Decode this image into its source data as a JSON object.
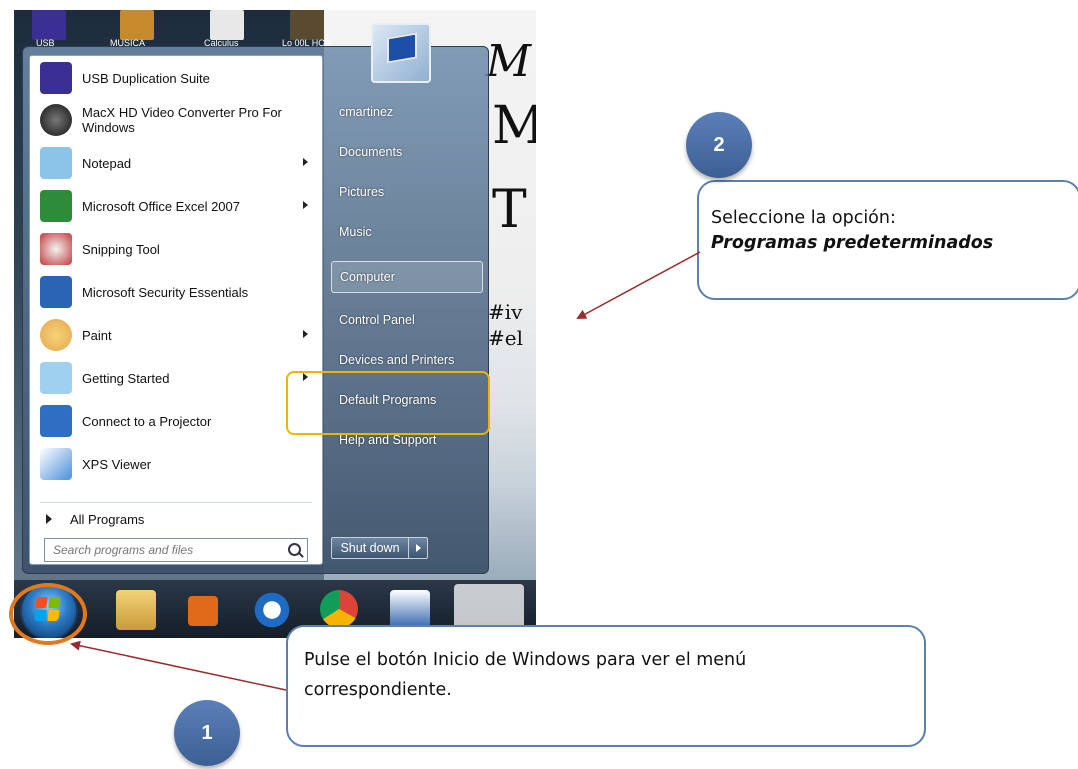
{
  "desktop": {
    "icon_labels": [
      "USB",
      "MUSICA",
      "Calculus",
      "Lo 00L HOB"
    ],
    "wallpaper_text": [
      "M",
      "M",
      "T",
      "#iv",
      "#el"
    ]
  },
  "start_menu": {
    "programs": [
      {
        "label": "USB Duplication Suite",
        "icon": "usb-duplication-icon",
        "color": "#3a2f95",
        "has_submenu": false
      },
      {
        "label": "MacX HD Video Converter Pro For Windows",
        "icon": "video-converter-icon",
        "color": "#2b2b2b",
        "has_submenu": false
      },
      {
        "label": "Notepad",
        "icon": "notepad-icon",
        "color": "#5fa7d6",
        "has_submenu": true
      },
      {
        "label": "Microsoft Office Excel 2007",
        "icon": "excel-icon",
        "color": "#2e8b3a",
        "has_submenu": true
      },
      {
        "label": "Snipping Tool",
        "icon": "scissors-icon",
        "color": "#c23b3b",
        "has_submenu": false
      },
      {
        "label": "Microsoft Security Essentials",
        "icon": "security-essentials-icon",
        "color": "#2b63b5",
        "has_submenu": false
      },
      {
        "label": "Paint",
        "icon": "paint-icon",
        "color": "#e3a64a",
        "has_submenu": true
      },
      {
        "label": "Getting Started",
        "icon": "getting-started-icon",
        "color": "#3f9bd8",
        "has_submenu": true
      },
      {
        "label": "Connect to a Projector",
        "icon": "projector-icon",
        "color": "#2e6fc1",
        "has_submenu": false
      },
      {
        "label": "XPS Viewer",
        "icon": "xps-viewer-icon",
        "color": "#4a90d9",
        "has_submenu": false
      }
    ],
    "all_programs": "All Programs",
    "search_placeholder": "Search programs and files",
    "right_links": {
      "user": "cmartinez",
      "documents": "Documents",
      "pictures": "Pictures",
      "music": "Music",
      "computer": "Computer",
      "control_panel": "Control Panel",
      "devices": "Devices and Printers",
      "default_programs": "Default Programs",
      "help": "Help and Support"
    },
    "shutdown_label": "Shut down"
  },
  "annotations": {
    "step2_number": "2",
    "step2_text": "Seleccione la opción:",
    "step2_emphasis": "Programas predeterminados",
    "step1_number": "1",
    "step1_text_line1": "Pulse el botón Inicio de Windows para ver  el menú",
    "step1_text_line2": "correspondiente.",
    "highlight_color": "#f0b400",
    "orb_highlight_color": "#e07a1c",
    "callout_border": "#5b7fb2",
    "arrow_color": "#9b2b2b"
  }
}
